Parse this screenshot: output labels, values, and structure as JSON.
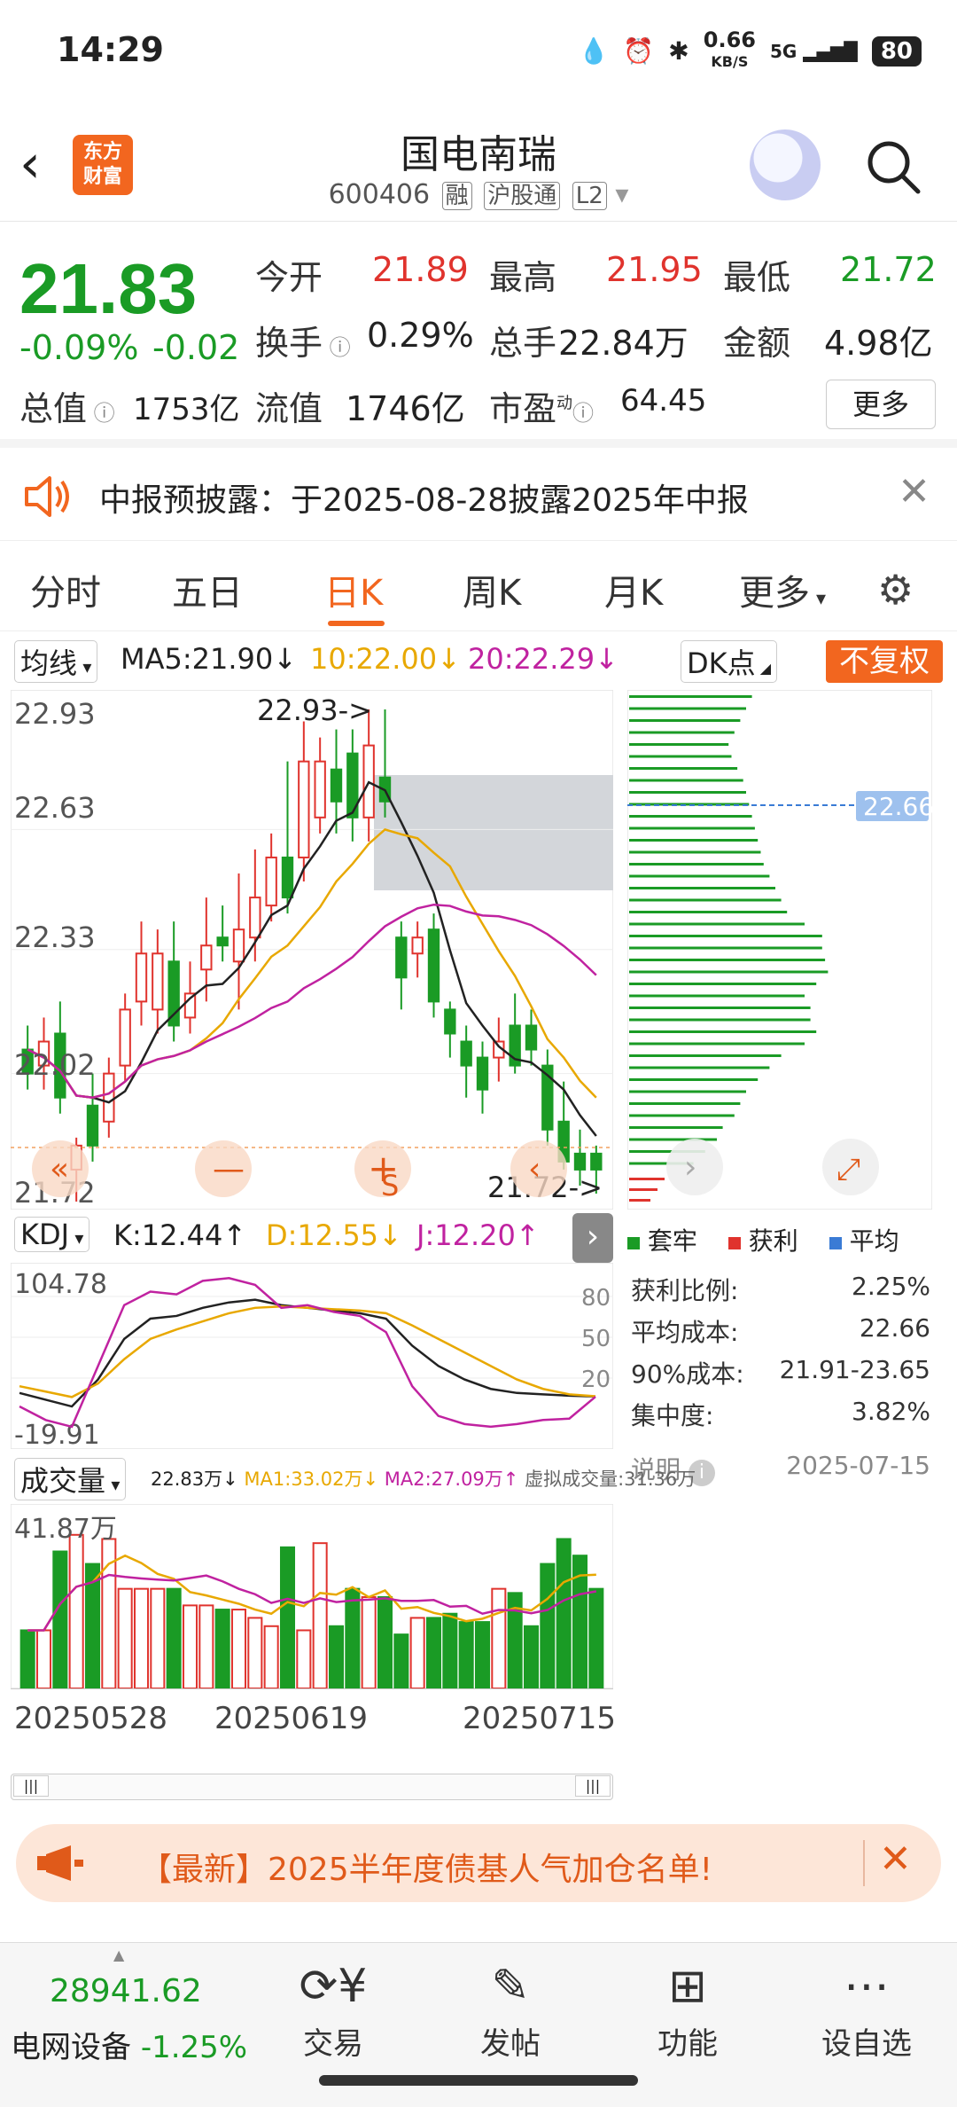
{
  "status": {
    "time": "14:29",
    "net_speed": "0.66",
    "net_unit": "KB/S",
    "signal": "5G",
    "battery": "80"
  },
  "header": {
    "title": "国电南瑞",
    "code": "600406",
    "tags": [
      "融",
      "沪股通",
      "L2"
    ],
    "logo_line1": "东方",
    "logo_line2": "财富"
  },
  "quote": {
    "price": "21.83",
    "change_pct": "-0.09%",
    "change": "-0.02",
    "open_label": "今开",
    "open": "21.89",
    "high_label": "最高",
    "high": "21.95",
    "low_label": "最低",
    "low": "21.72",
    "turnover_label": "换手",
    "turnover": "0.29%",
    "volume_label": "总手",
    "volume": "22.84万",
    "amount_label": "金额",
    "amount": "4.98亿",
    "mktcap_label": "总值",
    "mktcap": "1753亿",
    "float_label": "流值",
    "float": "1746亿",
    "pe_label": "市盈",
    "pe_sup": "动",
    "pe": "64.45",
    "more": "更多"
  },
  "notice": {
    "text": "中报预披露：于2025-08-28披露2025年中报"
  },
  "tabs": [
    "分时",
    "五日",
    "日K",
    "周K",
    "月K",
    "更多"
  ],
  "chart_bar": {
    "ma_select": "均线",
    "ma5": "MA5:21.90",
    "ma10": "10:22.00",
    "ma20": "20:22.29",
    "dk_select": "DK点",
    "adjust": "不复权"
  },
  "kchart": {
    "y_labels": [
      "22.93",
      "22.63",
      "22.33",
      "22.02",
      "21.72"
    ],
    "max_label": "22.93->",
    "min_label": "21.72->",
    "marker_s": "S"
  },
  "kdj": {
    "select": "KDJ",
    "k": "K:12.44",
    "d": "D:12.55",
    "j": "J:12.20",
    "y_top": "104.78",
    "y_bottom": "-19.91",
    "levels": [
      "80",
      "50",
      "20"
    ]
  },
  "volume": {
    "select": "成交量",
    "cur": "22.83万",
    "ma1": "MA1:33.02万",
    "ma2": "MA2:27.09万",
    "virtual": "虚拟成交量:31.36万",
    "y_top": "41.87万",
    "dates": [
      "20250528",
      "20250619",
      "20250715"
    ]
  },
  "chip": {
    "price_tag": "22.66",
    "legend": [
      "套牢",
      "获利",
      "平均"
    ],
    "rows": [
      {
        "label": "获利比例:",
        "value": "2.25%"
      },
      {
        "label": "平均成本:",
        "value": "22.66"
      },
      {
        "label": "90%成本:",
        "value": "21.91-23.65"
      },
      {
        "label": "集中度:",
        "value": "3.82%"
      }
    ],
    "note_label": "说明",
    "date": "2025-07-15"
  },
  "banner": {
    "text": "【最新】2025半年度债基人气加仓名单!"
  },
  "bottom": {
    "index_value": "28941.62",
    "index_name": "电网设备",
    "index_change": "-1.25%",
    "items": [
      "交易",
      "发帖",
      "功能",
      "设自选"
    ]
  },
  "colors": {
    "accent": "#f2661f",
    "up": "#e0332d",
    "down": "#1a9b25"
  },
  "chart_data": {
    "type": "candlestick",
    "candles": [
      {
        "o": 22.02,
        "c": 22.08,
        "h": 22.14,
        "l": 21.98,
        "up": false
      },
      {
        "o": 22.1,
        "c": 22.04,
        "h": 22.16,
        "l": 21.98,
        "up": true
      },
      {
        "o": 22.12,
        "c": 21.96,
        "h": 22.2,
        "l": 21.92,
        "up": false
      },
      {
        "o": 21.84,
        "c": 21.78,
        "h": 21.86,
        "l": 21.7,
        "up": true
      },
      {
        "o": 21.84,
        "c": 21.94,
        "h": 22.02,
        "l": 21.8,
        "up": false
      },
      {
        "o": 21.9,
        "c": 22.02,
        "h": 22.06,
        "l": 21.86,
        "up": true
      },
      {
        "o": 22.04,
        "c": 22.18,
        "h": 22.22,
        "l": 22.0,
        "up": true
      },
      {
        "o": 22.2,
        "c": 22.32,
        "h": 22.4,
        "l": 22.14,
        "up": true
      },
      {
        "o": 22.32,
        "c": 22.18,
        "h": 22.38,
        "l": 22.12,
        "up": true
      },
      {
        "o": 22.3,
        "c": 22.14,
        "h": 22.4,
        "l": 22.1,
        "up": false
      },
      {
        "o": 22.16,
        "c": 22.22,
        "h": 22.3,
        "l": 22.12,
        "up": true
      },
      {
        "o": 22.28,
        "c": 22.34,
        "h": 22.46,
        "l": 22.2,
        "up": true
      },
      {
        "o": 22.36,
        "c": 22.34,
        "h": 22.44,
        "l": 22.3,
        "up": false
      },
      {
        "o": 22.3,
        "c": 22.38,
        "h": 22.52,
        "l": 22.18,
        "up": true
      },
      {
        "o": 22.36,
        "c": 22.46,
        "h": 22.58,
        "l": 22.3,
        "up": true
      },
      {
        "o": 22.44,
        "c": 22.56,
        "h": 22.62,
        "l": 22.4,
        "up": true
      },
      {
        "o": 22.56,
        "c": 22.46,
        "h": 22.8,
        "l": 22.42,
        "up": false
      },
      {
        "o": 22.56,
        "c": 22.8,
        "h": 22.9,
        "l": 22.5,
        "up": true
      },
      {
        "o": 22.8,
        "c": 22.66,
        "h": 22.86,
        "l": 22.62,
        "up": true
      },
      {
        "o": 22.7,
        "c": 22.78,
        "h": 22.88,
        "l": 22.62,
        "up": false
      },
      {
        "o": 22.82,
        "c": 22.66,
        "h": 22.88,
        "l": 22.6,
        "up": false
      },
      {
        "o": 22.66,
        "c": 22.84,
        "h": 22.93,
        "l": 22.6,
        "up": true
      },
      {
        "o": 22.76,
        "c": 22.7,
        "h": 22.93,
        "l": 22.66,
        "up": false
      },
      {
        "o": 22.36,
        "c": 22.26,
        "h": 22.4,
        "l": 22.18,
        "up": false
      },
      {
        "o": 22.32,
        "c": 22.36,
        "h": 22.4,
        "l": 22.26,
        "up": true
      },
      {
        "o": 22.38,
        "c": 22.2,
        "h": 22.42,
        "l": 22.16,
        "up": false
      },
      {
        "o": 22.18,
        "c": 22.12,
        "h": 22.2,
        "l": 22.06,
        "up": false
      },
      {
        "o": 22.1,
        "c": 22.04,
        "h": 22.14,
        "l": 21.96,
        "up": false
      },
      {
        "o": 22.06,
        "c": 21.98,
        "h": 22.1,
        "l": 21.92,
        "up": false
      },
      {
        "o": 22.06,
        "c": 22.1,
        "h": 22.16,
        "l": 22.0,
        "up": true
      },
      {
        "o": 22.14,
        "c": 22.04,
        "h": 22.22,
        "l": 22.02,
        "up": false
      },
      {
        "o": 22.14,
        "c": 22.08,
        "h": 22.18,
        "l": 22.04,
        "up": false
      },
      {
        "o": 22.04,
        "c": 21.88,
        "h": 22.08,
        "l": 21.84,
        "up": false
      },
      {
        "o": 21.9,
        "c": 21.8,
        "h": 22.0,
        "l": 21.78,
        "up": false
      },
      {
        "o": 21.82,
        "c": 21.78,
        "h": 21.88,
        "l": 21.74,
        "up": false
      },
      {
        "o": 21.82,
        "c": 21.78,
        "h": 21.84,
        "l": 21.72,
        "up": false
      }
    ],
    "kdj_series": {
      "k": [
        15,
        10,
        5,
        25,
        55,
        70,
        72,
        78,
        82,
        84,
        80,
        78,
        76,
        74,
        70,
        50,
        35,
        25,
        18,
        15,
        14,
        13,
        12.44
      ],
      "d": [
        20,
        16,
        12,
        22,
        40,
        55,
        62,
        68,
        74,
        78,
        79,
        78,
        77,
        76,
        74,
        65,
        55,
        45,
        35,
        25,
        18,
        14,
        12.55
      ],
      "j": [
        5,
        -5,
        -10,
        35,
        80,
        90,
        88,
        98,
        100,
        95,
        78,
        80,
        75,
        72,
        60,
        20,
        -2,
        -8,
        -10,
        -8,
        -5,
        -4,
        12.2
      ]
    },
    "volume_values": [
      14,
      14,
      33,
      37,
      30,
      36,
      24,
      24,
      24,
      24,
      20,
      20,
      19,
      19,
      17,
      15,
      34,
      14,
      35,
      15,
      24,
      22,
      22,
      13,
      17,
      17,
      18,
      16,
      16,
      24,
      23,
      15,
      30,
      36,
      32,
      24
    ]
  }
}
